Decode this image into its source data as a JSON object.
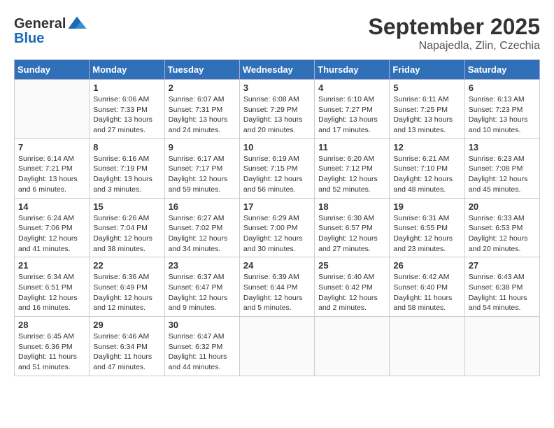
{
  "header": {
    "logo_line1": "General",
    "logo_line2": "Blue",
    "title": "September 2025",
    "subtitle": "Napajedla, Zlin, Czechia"
  },
  "calendar": {
    "days_of_week": [
      "Sunday",
      "Monday",
      "Tuesday",
      "Wednesday",
      "Thursday",
      "Friday",
      "Saturday"
    ],
    "weeks": [
      [
        {
          "day": "",
          "info": ""
        },
        {
          "day": "1",
          "info": "Sunrise: 6:06 AM\nSunset: 7:33 PM\nDaylight: 13 hours\nand 27 minutes."
        },
        {
          "day": "2",
          "info": "Sunrise: 6:07 AM\nSunset: 7:31 PM\nDaylight: 13 hours\nand 24 minutes."
        },
        {
          "day": "3",
          "info": "Sunrise: 6:08 AM\nSunset: 7:29 PM\nDaylight: 13 hours\nand 20 minutes."
        },
        {
          "day": "4",
          "info": "Sunrise: 6:10 AM\nSunset: 7:27 PM\nDaylight: 13 hours\nand 17 minutes."
        },
        {
          "day": "5",
          "info": "Sunrise: 6:11 AM\nSunset: 7:25 PM\nDaylight: 13 hours\nand 13 minutes."
        },
        {
          "day": "6",
          "info": "Sunrise: 6:13 AM\nSunset: 7:23 PM\nDaylight: 13 hours\nand 10 minutes."
        }
      ],
      [
        {
          "day": "7",
          "info": "Sunrise: 6:14 AM\nSunset: 7:21 PM\nDaylight: 13 hours\nand 6 minutes."
        },
        {
          "day": "8",
          "info": "Sunrise: 6:16 AM\nSunset: 7:19 PM\nDaylight: 13 hours\nand 3 minutes."
        },
        {
          "day": "9",
          "info": "Sunrise: 6:17 AM\nSunset: 7:17 PM\nDaylight: 12 hours\nand 59 minutes."
        },
        {
          "day": "10",
          "info": "Sunrise: 6:19 AM\nSunset: 7:15 PM\nDaylight: 12 hours\nand 56 minutes."
        },
        {
          "day": "11",
          "info": "Sunrise: 6:20 AM\nSunset: 7:12 PM\nDaylight: 12 hours\nand 52 minutes."
        },
        {
          "day": "12",
          "info": "Sunrise: 6:21 AM\nSunset: 7:10 PM\nDaylight: 12 hours\nand 48 minutes."
        },
        {
          "day": "13",
          "info": "Sunrise: 6:23 AM\nSunset: 7:08 PM\nDaylight: 12 hours\nand 45 minutes."
        }
      ],
      [
        {
          "day": "14",
          "info": "Sunrise: 6:24 AM\nSunset: 7:06 PM\nDaylight: 12 hours\nand 41 minutes."
        },
        {
          "day": "15",
          "info": "Sunrise: 6:26 AM\nSunset: 7:04 PM\nDaylight: 12 hours\nand 38 minutes."
        },
        {
          "day": "16",
          "info": "Sunrise: 6:27 AM\nSunset: 7:02 PM\nDaylight: 12 hours\nand 34 minutes."
        },
        {
          "day": "17",
          "info": "Sunrise: 6:29 AM\nSunset: 7:00 PM\nDaylight: 12 hours\nand 30 minutes."
        },
        {
          "day": "18",
          "info": "Sunrise: 6:30 AM\nSunset: 6:57 PM\nDaylight: 12 hours\nand 27 minutes."
        },
        {
          "day": "19",
          "info": "Sunrise: 6:31 AM\nSunset: 6:55 PM\nDaylight: 12 hours\nand 23 minutes."
        },
        {
          "day": "20",
          "info": "Sunrise: 6:33 AM\nSunset: 6:53 PM\nDaylight: 12 hours\nand 20 minutes."
        }
      ],
      [
        {
          "day": "21",
          "info": "Sunrise: 6:34 AM\nSunset: 6:51 PM\nDaylight: 12 hours\nand 16 minutes."
        },
        {
          "day": "22",
          "info": "Sunrise: 6:36 AM\nSunset: 6:49 PM\nDaylight: 12 hours\nand 12 minutes."
        },
        {
          "day": "23",
          "info": "Sunrise: 6:37 AM\nSunset: 6:47 PM\nDaylight: 12 hours\nand 9 minutes."
        },
        {
          "day": "24",
          "info": "Sunrise: 6:39 AM\nSunset: 6:44 PM\nDaylight: 12 hours\nand 5 minutes."
        },
        {
          "day": "25",
          "info": "Sunrise: 6:40 AM\nSunset: 6:42 PM\nDaylight: 12 hours\nand 2 minutes."
        },
        {
          "day": "26",
          "info": "Sunrise: 6:42 AM\nSunset: 6:40 PM\nDaylight: 11 hours\nand 58 minutes."
        },
        {
          "day": "27",
          "info": "Sunrise: 6:43 AM\nSunset: 6:38 PM\nDaylight: 11 hours\nand 54 minutes."
        }
      ],
      [
        {
          "day": "28",
          "info": "Sunrise: 6:45 AM\nSunset: 6:36 PM\nDaylight: 11 hours\nand 51 minutes."
        },
        {
          "day": "29",
          "info": "Sunrise: 6:46 AM\nSunset: 6:34 PM\nDaylight: 11 hours\nand 47 minutes."
        },
        {
          "day": "30",
          "info": "Sunrise: 6:47 AM\nSunset: 6:32 PM\nDaylight: 11 hours\nand 44 minutes."
        },
        {
          "day": "",
          "info": ""
        },
        {
          "day": "",
          "info": ""
        },
        {
          "day": "",
          "info": ""
        },
        {
          "day": "",
          "info": ""
        }
      ]
    ]
  }
}
